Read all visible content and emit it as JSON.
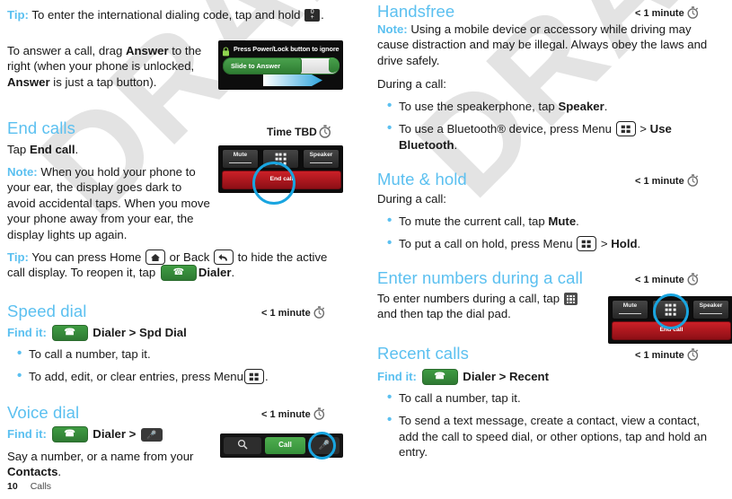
{
  "page": {
    "number": "10",
    "section": "Calls"
  },
  "timing_labels": {
    "under_minute": "< 1 minute",
    "time_tbd": "Time TBD"
  },
  "left_column": {
    "tip_international": {
      "lead": "Tip:",
      "text_before": " To enter the international dialing code, tap and hold ",
      "key_glyph": "zero-plus-key",
      "text_after": "."
    },
    "answer_paragraph": {
      "part1": "To answer a call, drag ",
      "bold1": "Answer",
      "part2": " to the right (when your phone is unlocked, ",
      "bold2": "Answer",
      "part3": " is just a tap button)."
    },
    "end_calls": {
      "heading": "End calls",
      "tap_text_before": "Tap ",
      "tap_bold": "End call",
      "tap_text_after": ".",
      "note": {
        "lead": "Note:",
        "text": " When you hold your phone to your ear, the display goes dark to avoid accidental taps. When you move your phone away from your ear, the display lights up again."
      },
      "tip": {
        "lead": "Tip:",
        "p1": " You can press Home ",
        "p2": " or Back ",
        "p3": " to hide the active call display. To reopen it, tap ",
        "p4": "Dialer",
        "p5": "."
      }
    },
    "speed_dial": {
      "heading": "Speed dial",
      "find_it_label": "Find it:",
      "find_it_path_1": "Dialer",
      "find_it_sep": ">",
      "find_it_path_2": "Spd Dial",
      "bullets": [
        "To call a number, tap it.",
        "To add, edit, or clear entries, press Menu"
      ],
      "bullet2_suffix": "."
    },
    "voice_dial": {
      "heading": "Voice dial",
      "find_it_label": "Find it:",
      "find_it_path_1": "Dialer",
      "find_it_sep": ">",
      "body_1": "Say a number, or a name from your ",
      "body_bold": "Contacts",
      "body_2": "."
    }
  },
  "right_column": {
    "handsfree": {
      "heading": "Handsfree",
      "note": {
        "lead": "Note:",
        "text": " Using a mobile device or accessory while driving may cause distraction and may be illegal. Always obey the laws and drive safely."
      },
      "during_call": "During a call:",
      "bullets": [
        {
          "pre": "To use the speakerphone, tap ",
          "bold": "Speaker",
          "post": "."
        },
        {
          "pre": "To use a Bluetooth® device, press Menu ",
          "bold": "Use Bluetooth",
          "post": ".",
          "sep": " > "
        }
      ]
    },
    "mute_hold": {
      "heading": "Mute & hold",
      "during_call": "During a call:",
      "bullets": [
        {
          "pre": "To mute the current call, tap ",
          "bold": "Mute",
          "post": "."
        },
        {
          "pre": "To put a call on hold, press Menu ",
          "bold": "Hold",
          "post": ".",
          "sep": " > "
        }
      ]
    },
    "enter_numbers": {
      "heading": "Enter numbers during a call",
      "body_1": "To enter numbers during a call, tap ",
      "body_2": " and then tap the dial pad."
    },
    "recent_calls": {
      "heading": "Recent calls",
      "find_it_label": "Find it:",
      "find_it_path_1": "Dialer",
      "find_it_sep": ">",
      "find_it_path_2": "Recent",
      "bullets": [
        "To call a number, tap it.",
        "To send a text message, create a contact, view a contact, add the call to speed dial, or other options, tap and hold an entry."
      ]
    }
  },
  "screenshots": {
    "incoming_call": {
      "status_text": "Press Power/Lock button to ignore",
      "slider_label": "Slide to Answer"
    },
    "active_call_left": {
      "mute": "Mute",
      "dialpad_icon": "dial-pad-icon",
      "speaker": "Speaker",
      "end_call": "End call"
    },
    "active_call_right": {
      "mute": "Mute",
      "dialpad_icon": "dial-pad-icon",
      "speaker": "Speaker",
      "end_call": "End call"
    },
    "dialer_bar": {
      "search_icon": "search-icon",
      "call": "Call",
      "voice_icon": "microphone-icon"
    }
  },
  "watermark": {
    "text": "DRAFT"
  },
  "colors": {
    "accent_blue": "#5bc0f0",
    "callout_ring": "#19a5e0",
    "green_button": "#3f9b42",
    "end_call_red": "#cc2027"
  }
}
